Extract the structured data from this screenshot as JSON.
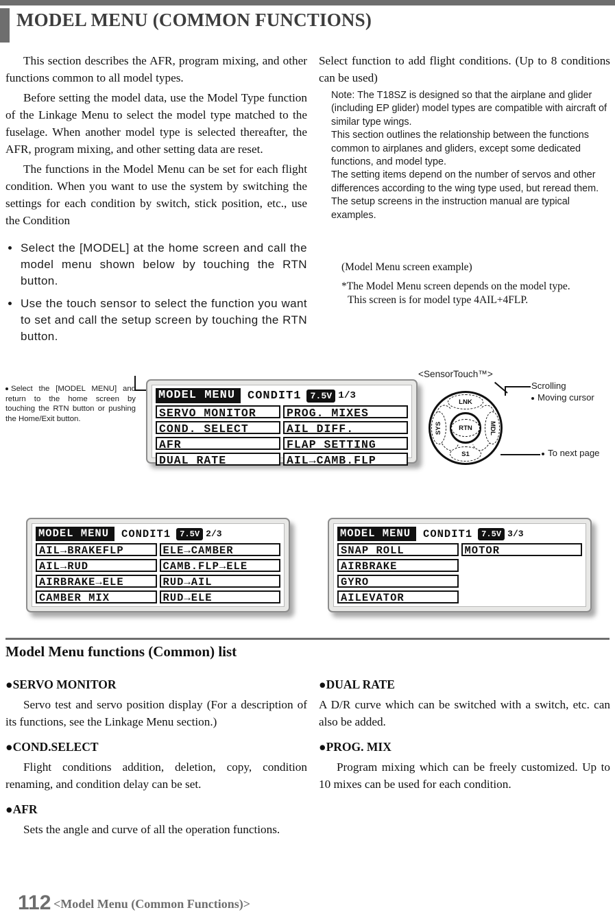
{
  "header": {
    "title": "MODEL MENU (COMMON FUNCTIONS)"
  },
  "intro": {
    "left_paragraphs": [
      "This section describes the AFR, program mixing, and other functions common to all model types.",
      "Before setting the model data, use the Model Type function of the Linkage Menu to select the model type matched to the fuselage. When another model type is selected thereafter, the AFR, program mixing, and other setting data are reset.",
      "The functions in the Model Menu can be set for each flight condition. When you want to use the system by switching the settings for each condition by switch, stick position, etc., use the Condition"
    ],
    "right_lead": "Select function to add flight conditions. (Up to 8 conditions can be used)",
    "note_lines": [
      "Note: The T18SZ is designed so that the airplane and glider (including EP glider) model types are compatible with aircraft of similar type wings.",
      "This section outlines the relationship between the functions common to airplanes and gliders, except some dedicated functions, and model type.",
      "The setting items depend on the number of servos and other differences according to the wing type used, but reread them. The setup screens in the instruction manual are typical examples."
    ],
    "bullets": [
      "Select the [MODEL] at the home screen and call the model menu shown below by touching the RTN button.",
      "Use the touch sensor to select the function you want to set and call the setup screen by touching the RTN button."
    ]
  },
  "caption": {
    "example_label": "(Model Menu screen example)",
    "note_line1": "*The Model Menu screen depends on the model type.",
    "note_line2": "This screen is for model type 4AIL+4FLP."
  },
  "callout_left": {
    "bullet_text": "Select the [MODEL MENU] and return to the home screen by touching the RTN button or pushing the Home/Exit button."
  },
  "screens": [
    {
      "id": "lcd-main",
      "title": "MODEL MENU",
      "condition": "CONDIT1",
      "voltage": "7.5V",
      "page": "1/3",
      "left_items": [
        "SERVO MONITOR",
        "COND. SELECT",
        "AFR",
        "DUAL RATE"
      ],
      "right_items": [
        "PROG. MIXES",
        "AIL DIFF.",
        "FLAP SETTING",
        "AIL→CAMB.FLP"
      ]
    },
    {
      "id": "lcd-2",
      "title": "MODEL MENU",
      "condition": "CONDIT1",
      "voltage": "7.5V",
      "page": "2/3",
      "left_items": [
        "AIL→BRAKEFLP",
        "AIL→RUD",
        "AIRBRAKE→ELE",
        "CAMBER MIX"
      ],
      "right_items": [
        "ELE→CAMBER",
        "CAMB.FLP→ELE",
        "RUD→AIL",
        "RUD→ELE"
      ]
    },
    {
      "id": "lcd-3",
      "title": "MODEL MENU",
      "condition": "CONDIT1",
      "voltage": "7.5V",
      "page": "3/3",
      "left_items": [
        "SNAP ROLL",
        "AIRBRAKE",
        "GYRO",
        "AILEVATOR"
      ],
      "right_items": [
        "MOTOR",
        "",
        "",
        ""
      ]
    }
  ],
  "sensor_touch": {
    "label": "<SensorTouch™>",
    "pads": {
      "top": "LNK",
      "left": "SYS",
      "right": "MDL",
      "bottom": "S1",
      "center": "RTN"
    },
    "annotations": {
      "scrolling": "Scrolling",
      "moving_cursor": "Moving cursor",
      "next_page": "To next page"
    }
  },
  "function_list": {
    "heading": "Model Menu functions (Common) list",
    "left": [
      {
        "name": "●SERVO MONITOR",
        "desc": "Servo test and servo position display (For a description of its functions, see the Linkage Menu section.)"
      },
      {
        "name": "●COND.SELECT",
        "desc": "Flight conditions addition, deletion, copy, condition renaming, and condition delay can be set."
      },
      {
        "name": "●AFR",
        "desc": "Sets the angle and curve of all the operation functions."
      }
    ],
    "right": [
      {
        "name": "●DUAL RATE",
        "desc": "A D/R curve which can be switched with a switch, etc. can also be added."
      },
      {
        "name": "●PROG. MIX",
        "desc": "Program mixing which can be freely customized. Up to 10 mixes can be used for each condition."
      }
    ]
  },
  "footer": {
    "page_number": "112",
    "page_label": "<Model Menu (Common Functions)>"
  }
}
